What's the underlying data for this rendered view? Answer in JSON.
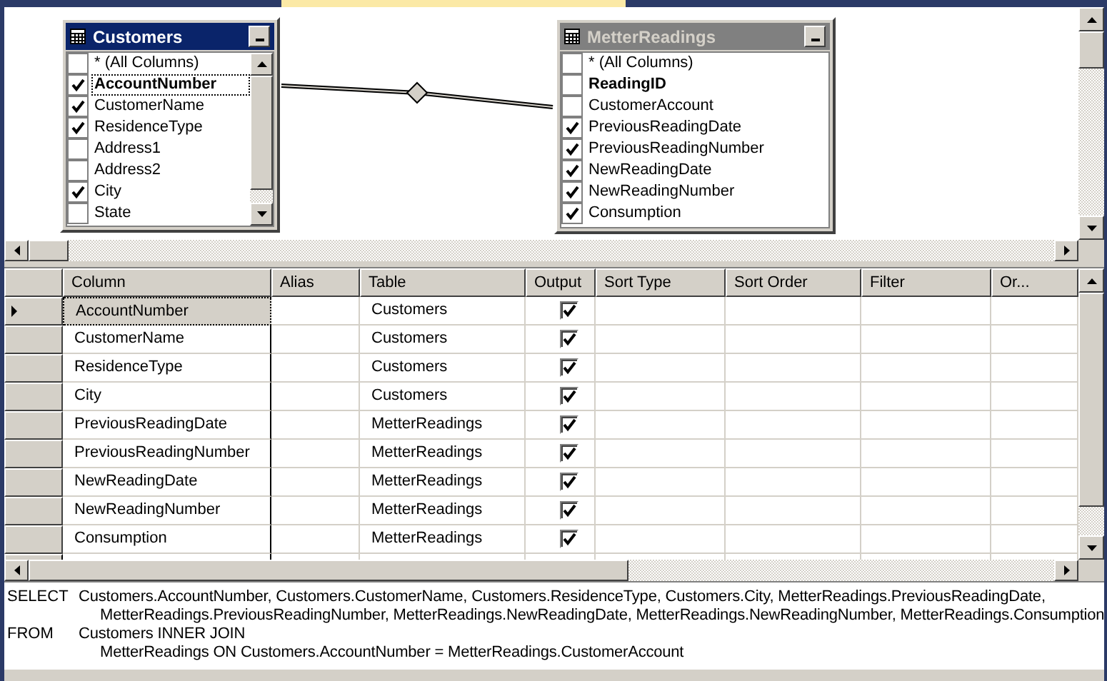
{
  "diagram": {
    "tables": [
      {
        "title": "Customers",
        "active": true,
        "columns": [
          {
            "name": "* (All Columns)",
            "checked": false,
            "key": false,
            "focused": false
          },
          {
            "name": "AccountNumber",
            "checked": true,
            "key": true,
            "focused": true
          },
          {
            "name": "CustomerName",
            "checked": true,
            "key": false,
            "focused": false
          },
          {
            "name": "ResidenceType",
            "checked": true,
            "key": false,
            "focused": false
          },
          {
            "name": "Address1",
            "checked": false,
            "key": false,
            "focused": false
          },
          {
            "name": "Address2",
            "checked": false,
            "key": false,
            "focused": false
          },
          {
            "name": "City",
            "checked": true,
            "key": false,
            "focused": false
          },
          {
            "name": "State",
            "checked": false,
            "key": false,
            "focused": false
          }
        ]
      },
      {
        "title": "MetterReadings",
        "active": false,
        "columns": [
          {
            "name": "* (All Columns)",
            "checked": false,
            "key": false,
            "focused": false
          },
          {
            "name": "ReadingID",
            "checked": false,
            "key": true,
            "focused": false
          },
          {
            "name": "CustomerAccount",
            "checked": false,
            "key": false,
            "focused": false
          },
          {
            "name": "PreviousReadingDate",
            "checked": true,
            "key": false,
            "focused": false
          },
          {
            "name": "PreviousReadingNumber",
            "checked": true,
            "key": false,
            "focused": false
          },
          {
            "name": "NewReadingDate",
            "checked": true,
            "key": false,
            "focused": false
          },
          {
            "name": "NewReadingNumber",
            "checked": true,
            "key": false,
            "focused": false
          },
          {
            "name": "Consumption",
            "checked": true,
            "key": false,
            "focused": false
          }
        ]
      }
    ]
  },
  "grid": {
    "columns": [
      "Column",
      "Alias",
      "Table",
      "Output",
      "Sort Type",
      "Sort Order",
      "Filter",
      "Or..."
    ],
    "rows": [
      {
        "column": "AccountNumber",
        "table": "Customers",
        "output": true,
        "selected": true
      },
      {
        "column": "CustomerName",
        "table": "Customers",
        "output": true,
        "selected": false
      },
      {
        "column": "ResidenceType",
        "table": "Customers",
        "output": true,
        "selected": false
      },
      {
        "column": "City",
        "table": "Customers",
        "output": true,
        "selected": false
      },
      {
        "column": "PreviousReadingDate",
        "table": "MetterReadings",
        "output": true,
        "selected": false
      },
      {
        "column": "PreviousReadingNumber",
        "table": "MetterReadings",
        "output": true,
        "selected": false
      },
      {
        "column": "NewReadingDate",
        "table": "MetterReadings",
        "output": true,
        "selected": false
      },
      {
        "column": "NewReadingNumber",
        "table": "MetterReadings",
        "output": true,
        "selected": false
      },
      {
        "column": "Consumption",
        "table": "MetterReadings",
        "output": true,
        "selected": false
      }
    ]
  },
  "sql": [
    {
      "keyword": "SELECT",
      "lines": [
        "Customers.AccountNumber, Customers.CustomerName, Customers.ResidenceType, Customers.City, MetterReadings.PreviousReadingDate,",
        "MetterReadings.PreviousReadingNumber, MetterReadings.NewReadingDate, MetterReadings.NewReadingNumber, MetterReadings.Consumption"
      ]
    },
    {
      "keyword": "FROM",
      "lines": [
        "Customers INNER JOIN",
        "MetterReadings ON Customers.AccountNumber = MetterReadings.CustomerAccount"
      ]
    }
  ]
}
